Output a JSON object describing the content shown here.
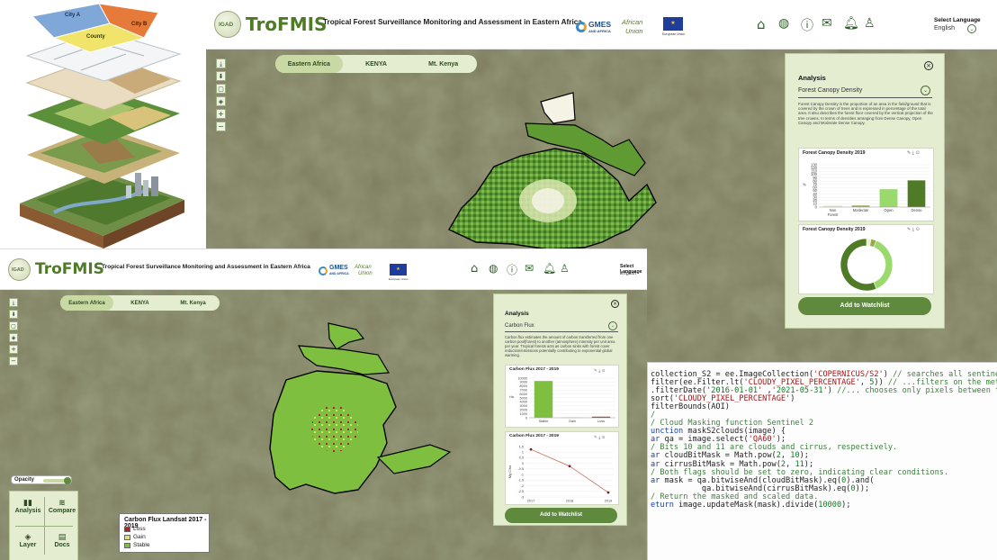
{
  "layers_illustration": {
    "region_labels": [
      "City A",
      "County",
      "City B"
    ]
  },
  "top_app": {
    "logo_badge": "IGAD",
    "app_name": "TroFMIS",
    "tagline": "Tropical Forest Surveillance Monitoring and Assessment in Eastern Africa",
    "partners": [
      "GMES",
      "AND AFRICA",
      "African",
      "Union",
      "European Union"
    ],
    "nav_icons": [
      "home-icon",
      "globe-icon",
      "info-icon",
      "mail-icon",
      "bell-icon",
      "user-icon"
    ],
    "language": {
      "label": "Select Language",
      "value": "English"
    },
    "breadcrumbs": [
      "Eastern Africa",
      "KENYA",
      "Mt. Kenya"
    ],
    "zoom_controls": [
      "download-icon",
      "download-alt-icon",
      "frame-icon",
      "layers-icon",
      "+",
      "−"
    ],
    "analysis": {
      "title": "Analysis",
      "select_value": "Forest Canopy Density",
      "description": "Forest Canopy Density is the proportion of an area in the field/ground that is covered by the crown of trees and is expressed in percentage of the total area. It also describes the forest floor covered by the vertical projection of the tree crowns. In terms of densities arranging from Dense Canopy, Open Canopy and Moderate Dense Canopy.",
      "bar_chart_title": "Forest Canopy Density 2019",
      "donut_chart_title": "Forest Canopy Density 2019",
      "button": "Add to Watchlist"
    }
  },
  "bottom_app": {
    "logo_badge": "IGAD",
    "app_name": "TroFMIS",
    "tagline": "Tropical Forest Surveillance Monitoring and Assessment in Eastern Africa",
    "partners": [
      "GMES",
      "AND AFRICA",
      "African",
      "Union",
      "European Union"
    ],
    "language": {
      "label": "Select Language",
      "value": "English"
    },
    "breadcrumbs": [
      "Eastern Africa",
      "KENYA",
      "Mt. Kenya"
    ],
    "analysis": {
      "title": "Analysis",
      "select_value": "Carbon Flux",
      "description": "Carbon flux estimates the amount of carbon transferred from one carbon pool(forest) to another (atmosphere) intensity per unit area per year. Tropical forests acts as carbon sinks with forest cover reduction/emissions potentially contributing to exponential global warming.",
      "bar_chart_title": "Carbon Flux 2017 - 2019",
      "line_chart_title": "Carbon Flux 2017 - 2019",
      "button": "Add to Watchlist"
    },
    "opacity_label": "Opacity",
    "tools": [
      {
        "icon": "analysis-icon",
        "label": "Analysis"
      },
      {
        "icon": "compare-icon",
        "label": "Compare"
      },
      {
        "icon": "layer-icon",
        "label": "Layer"
      },
      {
        "icon": "docs-icon",
        "label": "Docs"
      }
    ],
    "legend": {
      "title": "Carbon Flux Landsat 2017 - 2019",
      "items": [
        {
          "label": "Loss",
          "color": "#b22222"
        },
        {
          "label": "Gain",
          "color": "#d9e66a"
        },
        {
          "label": "Stable",
          "color": "#7fbf3f"
        }
      ]
    }
  },
  "chart_data": [
    {
      "type": "bar",
      "title": "Forest Canopy Density 2019",
      "categories": [
        "Non Forest",
        "Moderate",
        "Open",
        "Dense"
      ],
      "values": [
        4,
        5,
        55,
        82
      ],
      "ylabel": "%",
      "yticks": [
        "0",
        "10",
        "20",
        "30",
        "40",
        "50",
        "60",
        "70",
        "80",
        "90",
        "100",
        "110",
        "120",
        "130"
      ],
      "ylim": [
        0,
        130
      ],
      "colors": [
        "#e7efd5",
        "#9aa84b",
        "#9ad96b",
        "#4f7a26"
      ]
    },
    {
      "type": "pie",
      "title": "Forest Canopy Density 2019",
      "categories": [
        "Non Forest",
        "Moderate",
        "Open",
        "Dense"
      ],
      "values": [
        4,
        5,
        55,
        82
      ],
      "colors": [
        "#e7efd5",
        "#9aa84b",
        "#9ad96b",
        "#4f7a26"
      ]
    },
    {
      "type": "bar",
      "title": "Carbon Flux 2017 - 2019",
      "categories": [
        "Stable",
        "Gain",
        "Loss"
      ],
      "values": [
        9300,
        40,
        300
      ],
      "ylabel": "Ha",
      "yticks": [
        "0",
        "1000",
        "2000",
        "3000",
        "4000",
        "5000",
        "6000",
        "7000",
        "8000",
        "9000",
        "10000"
      ],
      "ylim": [
        0,
        10000
      ],
      "colors": [
        "#7fbf3f",
        "#d9e66a",
        "#b22222"
      ]
    },
    {
      "type": "line",
      "title": "Carbon Flux 2017 - 2019",
      "x": [
        "2017",
        "2018",
        "2019"
      ],
      "y": [
        1.25,
        -0.25,
        -2.6
      ],
      "ylabel": "Mg C/ha",
      "yticks": [
        "1.5",
        "1",
        "0.5",
        "0",
        "-0.5",
        "-1",
        "-1.5",
        "-2",
        "-2.5",
        "-3"
      ],
      "ylim": [
        -3,
        1.5
      ]
    }
  ],
  "code": {
    "lines": [
      "collection_S2 = ee.ImageCollection('COPERNICUS/S2') // searches all sentinel 2 imagery p",
      "filter(ee.Filter.lt('CLOUDY_PIXEL_PERCENTAGE', 5)) // ...filters on the metadata for pixe",
      ".filterDate('2016-01-01' ,'2021-05-31') //... chooses only pixels between the dates you",
      "sort('CLOUDY_PIXEL_PERCENTAGE')",
      "filterBounds(AOI)",
      "/",
      "",
      "/ Cloud Masking function Sentinel 2",
      "unction maskS2clouds(image) {",
      "ar qa = image.select('QA60');",
      "",
      "/ Bits 10 and 11 are clouds and cirrus, respectively.",
      "ar cloudBitMask = Math.pow(2, 10);",
      "ar cirrusBitMask = Math.pow(2, 11);",
      "",
      "/ Both flags should be set to zero, indicating clear conditions.",
      "ar mask = qa.bitwiseAnd(cloudBitMask).eq(0).and(",
      "           qa.bitwiseAnd(cirrusBitMask).eq(0));",
      "",
      "/ Return the masked and scaled data.",
      "eturn image.updateMask(mask).divide(10000);"
    ]
  }
}
